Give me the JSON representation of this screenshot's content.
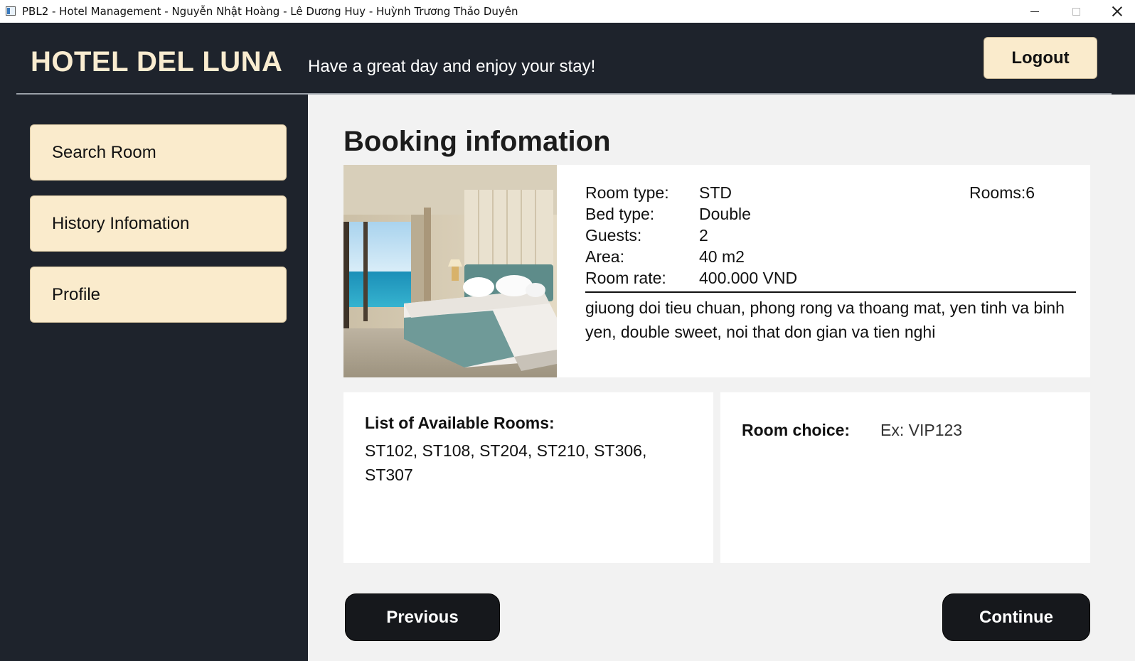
{
  "window": {
    "title": "PBL2 - Hotel Management - Nguyễn Nhật Hoàng - Lê Dương Huy - Huỳnh Trương Thảo Duyên",
    "icon": "app-window-icon",
    "controls": [
      "minimize-icon",
      "maximize-icon",
      "close-icon"
    ]
  },
  "header": {
    "brand": "HOTEL DEL LUNA",
    "tagline": "Have a great day and enjoy your stay!",
    "logout_label": "Logout"
  },
  "sidebar": {
    "items": [
      {
        "label": "Search Room"
      },
      {
        "label": "History Infomation"
      },
      {
        "label": "Profile"
      }
    ]
  },
  "main": {
    "title": "Booking infomation",
    "room": {
      "image": "hotel-room-photo",
      "fields": [
        {
          "label": "Room type:",
          "value": "STD"
        },
        {
          "label": "Bed type:",
          "value": "Double"
        },
        {
          "label": "Guests:",
          "value": "2"
        },
        {
          "label": "Area:",
          "value": "40 m2"
        },
        {
          "label": "Room rate:",
          "value": "400.000 VND"
        }
      ],
      "rooms_count": "Rooms:6",
      "description": "giuong doi tieu chuan, phong rong va thoang mat, yen tinh va binh yen, double sweet, noi that don gian va tien nghi"
    },
    "available": {
      "title": "List of Available Rooms:",
      "list": "ST102, ST108, ST204, ST210, ST306, ST307"
    },
    "choice": {
      "label": "Room choice:",
      "value": "",
      "placeholder": "Ex: VIP123"
    },
    "previous_label": "Previous",
    "continue_label": "Continue"
  },
  "colors": {
    "background_dark": "#1e232c",
    "button_cream": "#faebcc",
    "content_bg": "#f2f2f2",
    "nav_button": "#16181c",
    "brand_text": "#faecd0"
  }
}
